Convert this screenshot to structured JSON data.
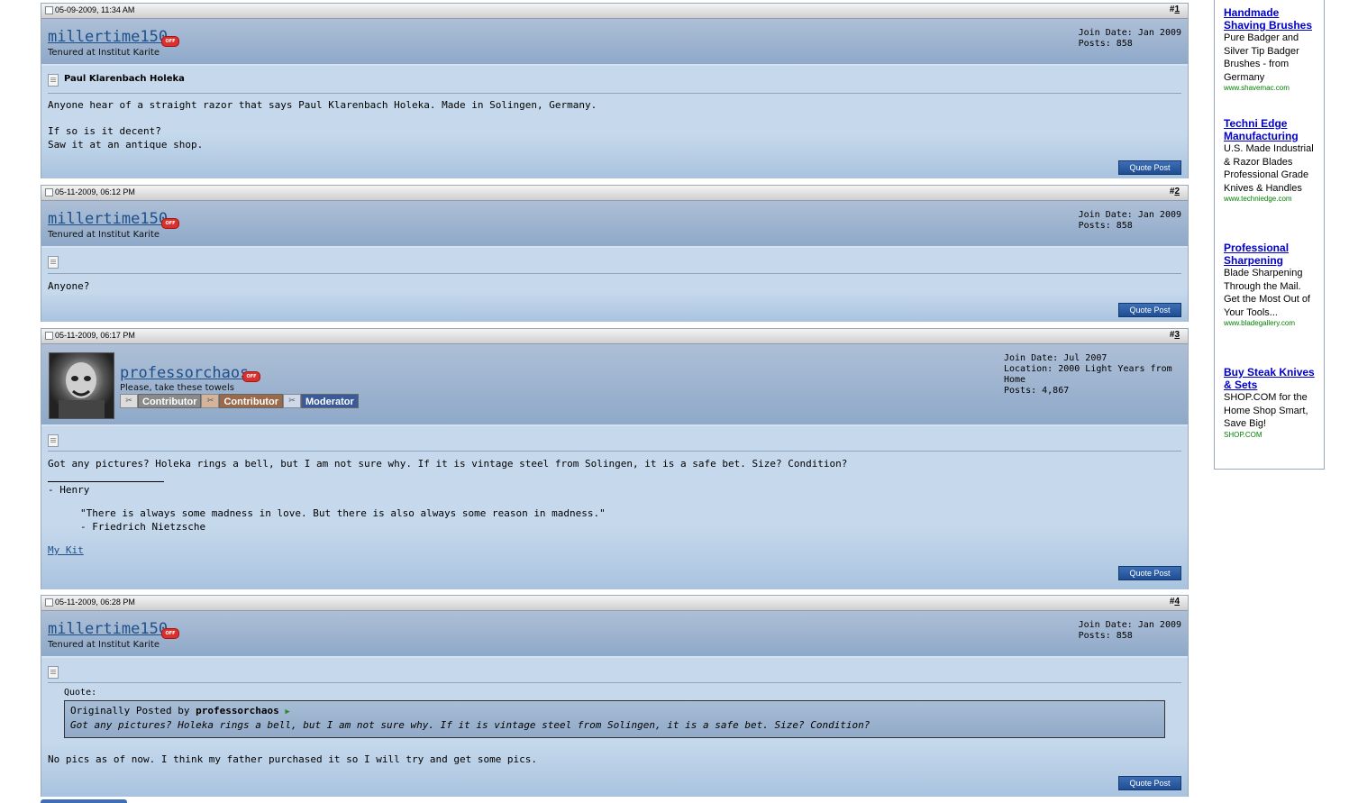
{
  "posts": [
    {
      "date": "05-09-2009, 11:34 AM",
      "number": "1",
      "username": "millertime150",
      "status": "OFF",
      "user_title": "Tenured at Institut Karite",
      "join_date": "Join Date: Jan 2009",
      "posts": "Posts: 858",
      "post_title": "Paul Klarenbach Holeka",
      "text": "Anyone hear of a straight razor that says Paul Klarenbach Holeka. Made in Solingen, Germany.\n\nIf so is it decent?\nSaw it at an antique shop.",
      "quote_label": "Quote Post"
    },
    {
      "date": "05-11-2009, 06:12 PM",
      "number": "2",
      "username": "millertime150",
      "status": "OFF",
      "user_title": "Tenured at Institut Karite",
      "join_date": "Join Date: Jan 2009",
      "posts": "Posts: 858",
      "text": "Anyone?",
      "quote_label": "Quote Post"
    },
    {
      "date": "05-11-2009, 06:17 PM",
      "number": "3",
      "username": "professorchaos",
      "status": "OFF",
      "user_title": "Please, take these towels",
      "ranks": [
        "Contributor",
        "Contributor",
        "Moderator"
      ],
      "join_date": "Join Date: Jul 2007",
      "location": "Location: 2000 Light Years from Home",
      "posts": "Posts: 4,867",
      "text": "Got any pictures? Holeka rings a bell, but I am not sure why. If it is vintage steel from Solingen, it is a safe bet. Size? Condition?",
      "sig_separator": "__________________",
      "sig_name": "- Henry",
      "sig_quote": "\"There is always some madness in love. But there is also always some reason in madness.\"\n- Friedrich Nietzsche",
      "sig_link": "My Kit",
      "quote_label": "Quote Post"
    },
    {
      "date": "05-11-2009, 06:28 PM",
      "number": "4",
      "username": "millertime150",
      "status": "OFF",
      "user_title": "Tenured at Institut Karite",
      "join_date": "Join Date: Jan 2009",
      "posts": "Posts: 858",
      "quote_header": "Quote:",
      "quote_prefix": "Originally Posted by",
      "quote_author": "professorchaos",
      "quote_text": "Got any pictures? Holeka rings a bell, but I am not sure why. If it is vintage steel from Solingen, it is a safe bet. Size? Condition?",
      "text": "No pics as of now. I think my father purchased it so I will try and get some pics.",
      "quote_label": "Quote Post"
    }
  ],
  "ads": [
    {
      "title": "Handmade Shaving Brushes",
      "text": "Pure Badger and Silver Tip Badger Brushes - from Germany",
      "url": "www.shavemac.com"
    },
    {
      "title": "Techni Edge Manufacturing",
      "text": "U.S. Made Industrial & Razor Blades Professional Grade Knives & Handles",
      "url": "www.techniedge.com"
    },
    {
      "title": "Professional Sharpening",
      "text": "Blade Sharpening Through the Mail. Get the Most Out of Your Tools...",
      "url": "www.bladegallery.com"
    },
    {
      "title": "Buy Steak Knives & Sets",
      "text": "SHOP.COM for the Home Shop Smart, Save Big!",
      "url": "SHOP.COM"
    }
  ],
  "colors": {
    "username": "#1d4f8a",
    "post_bg": "#c6d9ec",
    "quote_button": "#2a5aa0",
    "ad_title": "#0000cc",
    "ad_url": "#008000"
  }
}
